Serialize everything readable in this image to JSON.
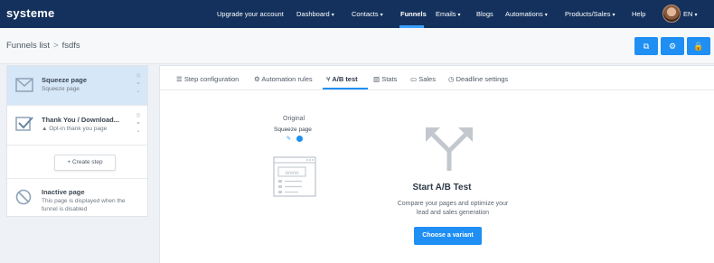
{
  "app": {
    "logo": "systeme"
  },
  "nav": {
    "items": [
      {
        "label": "Upgrade your account",
        "caret": ""
      },
      {
        "label": "Dashboard",
        "caret": "▾"
      },
      {
        "label": "Contacts",
        "caret": "▾"
      },
      {
        "label": "Funnels",
        "caret": ""
      },
      {
        "label": "Emails",
        "caret": "▾"
      },
      {
        "label": "Blogs",
        "caret": ""
      },
      {
        "label": "Automations",
        "caret": "▾"
      },
      {
        "label": "Products/Sales",
        "caret": "▾"
      },
      {
        "label": "Help",
        "caret": ""
      }
    ],
    "active": "Funnels",
    "lang": "EN",
    "lang_caret": "▾"
  },
  "breadcrumb": {
    "parent": "Funnels list",
    "separator": ">",
    "current": "fsdfs"
  },
  "toolbar": {
    "buttons": [
      {
        "icon": "external-link-icon",
        "glyph": "⧉"
      },
      {
        "icon": "settings-icon",
        "glyph": "⚙"
      },
      {
        "icon": "lock-icon",
        "glyph": "🔒"
      }
    ]
  },
  "steps": [
    {
      "title": "Squeeze page",
      "subtitle": "Squeeze page",
      "icon": "mail-icon",
      "selected": true
    },
    {
      "title": "Thank You / Download...",
      "subtitle": "Opt-in thank you page",
      "icon": "check-icon",
      "warning": "▲",
      "selected": false
    }
  ],
  "create_step": {
    "label": "+ Create step"
  },
  "inactive": {
    "title": "Inactive page",
    "subtitle_line1": "This page is displayed when the",
    "subtitle_line2": "funnel is disabled"
  },
  "tabs": [
    {
      "label": "Step configuration",
      "icon": "list-icon",
      "glyph": "☰"
    },
    {
      "label": "Automation rules",
      "icon": "gears-icon",
      "glyph": "⚙"
    },
    {
      "label": "A/B test",
      "icon": "split-icon",
      "glyph": "⑂"
    },
    {
      "label": "Stats",
      "icon": "bar-chart-icon",
      "glyph": "▥"
    },
    {
      "label": "Sales",
      "icon": "money-icon",
      "glyph": "▭"
    },
    {
      "label": "Deadline settings",
      "icon": "clock-icon",
      "glyph": "◷"
    }
  ],
  "active_tab": "A/B test",
  "ab_test": {
    "original_label": "Original",
    "original_page": "Squeeze page",
    "title": "Start A/B Test",
    "desc_line1": "Compare your pages and optimize your",
    "desc_line2": "lead and sales generation",
    "button": "Choose a variant"
  },
  "colors": {
    "navbar": "#13315c",
    "accent": "#1f8ff3",
    "selected_step": "#d6e7f7"
  }
}
